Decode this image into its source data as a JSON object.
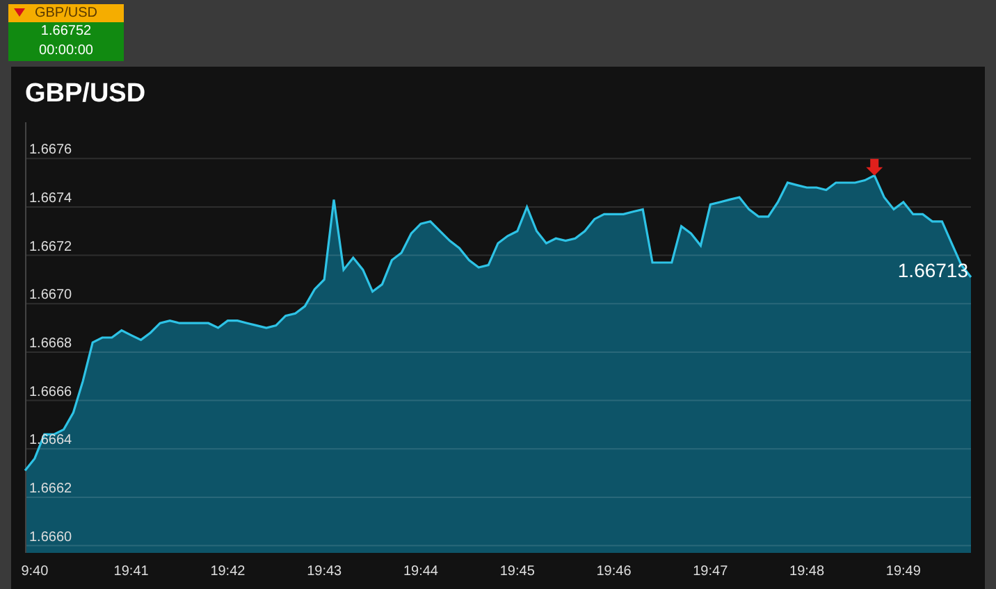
{
  "ticker": {
    "symbol": "GBP/USD",
    "price": "1.66752",
    "time": "00:00:00"
  },
  "chart_panel": {
    "title": "GBP/USD",
    "chart_data": {
      "type": "area",
      "ylim": [
        1.66597,
        1.66775
      ],
      "categories": [
        null,
        "9:40",
        null,
        null,
        null,
        null,
        null,
        null,
        null,
        null,
        null,
        "19:41",
        null,
        null,
        null,
        null,
        null,
        null,
        null,
        null,
        null,
        "19:42",
        null,
        null,
        null,
        null,
        null,
        null,
        null,
        null,
        null,
        "19:43",
        null,
        null,
        null,
        null,
        null,
        null,
        null,
        null,
        null,
        "19:44",
        null,
        null,
        null,
        null,
        null,
        null,
        null,
        null,
        null,
        "19:45",
        null,
        null,
        null,
        null,
        null,
        null,
        null,
        null,
        null,
        "19:46",
        null,
        null,
        null,
        null,
        null,
        null,
        null,
        null,
        null,
        "19:47",
        null,
        null,
        null,
        null,
        null,
        null,
        null,
        null,
        null,
        "19:48",
        null,
        null,
        null,
        null,
        null,
        null,
        null,
        null,
        null,
        "19:49",
        null,
        null,
        null,
        null,
        null,
        null,
        null
      ],
      "yticks": [
        {
          "value": 1.666,
          "label": "1.6660"
        },
        {
          "value": 1.6662,
          "label": "1.6662"
        },
        {
          "value": 1.6664,
          "label": "1.6664"
        },
        {
          "value": 1.6666,
          "label": "1.6666"
        },
        {
          "value": 1.6668,
          "label": "1.6668"
        },
        {
          "value": 1.667,
          "label": "1.6670"
        },
        {
          "value": 1.6672,
          "label": "1.6672"
        },
        {
          "value": 1.6674,
          "label": "1.6674"
        },
        {
          "value": 1.6676,
          "label": "1.6676"
        }
      ],
      "series": [
        {
          "color": "#2ec3e6",
          "values": [
            1.66631,
            1.66636,
            1.66646,
            1.66646,
            1.66648,
            1.66655,
            1.66668,
            1.66684,
            1.66686,
            1.66686,
            1.66689,
            1.66687,
            1.66685,
            1.66688,
            1.66692,
            1.66693,
            1.66692,
            1.66692,
            1.66692,
            1.66692,
            1.6669,
            1.66693,
            1.66693,
            1.66692,
            1.66691,
            1.6669,
            1.66691,
            1.66695,
            1.66696,
            1.66699,
            1.66706,
            1.6671,
            1.66743,
            1.66714,
            1.66719,
            1.66714,
            1.66705,
            1.66708,
            1.66718,
            1.66721,
            1.66729,
            1.66733,
            1.66734,
            1.6673,
            1.66726,
            1.66723,
            1.66718,
            1.66715,
            1.66716,
            1.66725,
            1.66728,
            1.6673,
            1.6674,
            1.6673,
            1.66725,
            1.66727,
            1.66726,
            1.66727,
            1.6673,
            1.66735,
            1.66737,
            1.66737,
            1.66737,
            1.66738,
            1.66739,
            1.66717,
            1.66717,
            1.66717,
            1.66732,
            1.66729,
            1.66724,
            1.66741,
            1.66742,
            1.66743,
            1.66744,
            1.66739,
            1.66736,
            1.66736,
            1.66742,
            1.6675,
            1.66749,
            1.66748,
            1.66748,
            1.66747,
            1.6675,
            1.6675,
            1.6675,
            1.66751,
            1.66753,
            1.66744,
            1.66739,
            1.66742,
            1.66737,
            1.66737,
            1.66734,
            1.66734,
            1.66725,
            1.66716,
            1.66711
          ]
        }
      ],
      "grid": true
    },
    "last_price": "1.66713"
  }
}
